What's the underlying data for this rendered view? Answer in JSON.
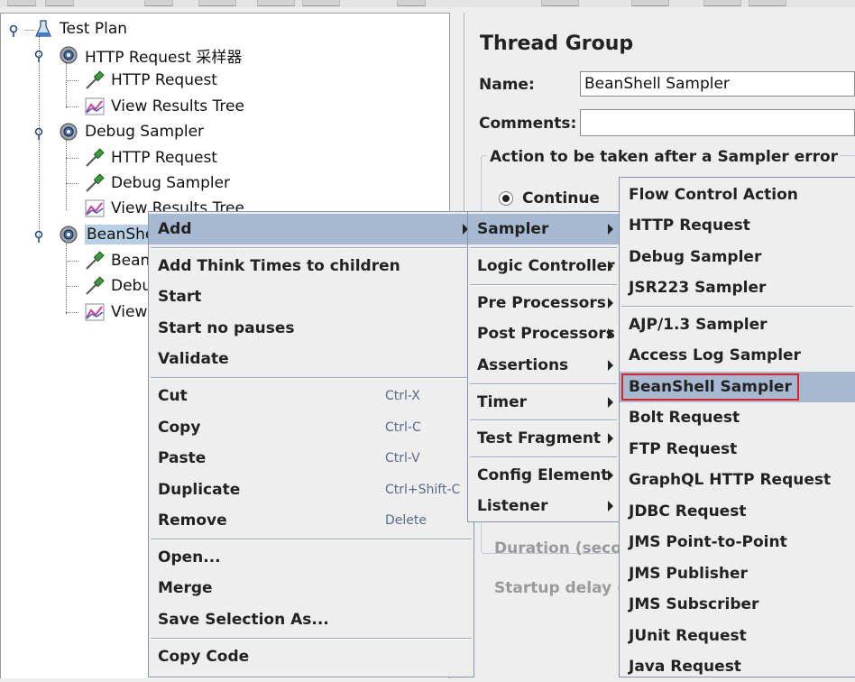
{
  "tree": {
    "items": [
      {
        "label": "Test Plan"
      },
      {
        "label": "HTTP Request 采样器"
      },
      {
        "label": "HTTP Request"
      },
      {
        "label": "View Results Tree"
      },
      {
        "label": "Debug Sampler"
      },
      {
        "label": "HTTP Request"
      },
      {
        "label": "Debug Sampler"
      },
      {
        "label": "View Results Tree"
      },
      {
        "label": "BeanShe"
      },
      {
        "label": "Bean"
      },
      {
        "label": "Debu"
      },
      {
        "label": "View"
      }
    ]
  },
  "form": {
    "title": "Thread Group",
    "name_label": "Name:",
    "name_value": "BeanShell Sampler",
    "comments_label": "Comments:",
    "comments_value": "",
    "error_group_title": "Action to be taken after a Sampler error",
    "continue_label": "Continue",
    "duration_label": "Duration (secon",
    "startup_delay_label": "Startup delay (s"
  },
  "context_menu": {
    "add": "Add",
    "add_think_times": "Add Think Times to children",
    "start": "Start",
    "start_no_pauses": "Start no pauses",
    "validate": "Validate",
    "cut": "Cut",
    "cut_shortcut": "Ctrl-X",
    "copy": "Copy",
    "copy_shortcut": "Ctrl-C",
    "paste": "Paste",
    "paste_shortcut": "Ctrl-V",
    "duplicate": "Duplicate",
    "duplicate_shortcut": "Ctrl+Shift-C",
    "remove": "Remove",
    "remove_shortcut": "Delete",
    "open": "Open...",
    "merge": "Merge",
    "save_selection": "Save Selection As...",
    "copy_code": "Copy Code"
  },
  "add_submenu": {
    "sampler": "Sampler",
    "logic_controller": "Logic Controller",
    "pre_processors": "Pre Processors",
    "post_processors": "Post Processors",
    "assertions": "Assertions",
    "timer": "Timer",
    "test_fragment": "Test Fragment",
    "config_element": "Config Element",
    "listener": "Listener"
  },
  "sampler_submenu": {
    "items": [
      "Flow Control Action",
      "HTTP Request",
      "Debug Sampler",
      "JSR223 Sampler",
      "AJP/1.3 Sampler",
      "Access Log Sampler",
      "BeanShell Sampler",
      "Bolt Request",
      "FTP Request",
      "GraphQL HTTP Request",
      "JDBC Request",
      "JMS Point-to-Point",
      "JMS Publisher",
      "JMS Subscriber",
      "JUnit Request",
      "Java Request"
    ],
    "highlighted": "BeanShell Sampler"
  },
  "colors": {
    "menu_highlight": "#a7b9d0",
    "tree_selection": "#b8cfe5",
    "callout_border": "#e02020"
  },
  "icons": {
    "test_plan": "flask-icon",
    "thread_group": "gear-icon",
    "sampler": "pipette-icon",
    "listener": "chart-icon"
  }
}
